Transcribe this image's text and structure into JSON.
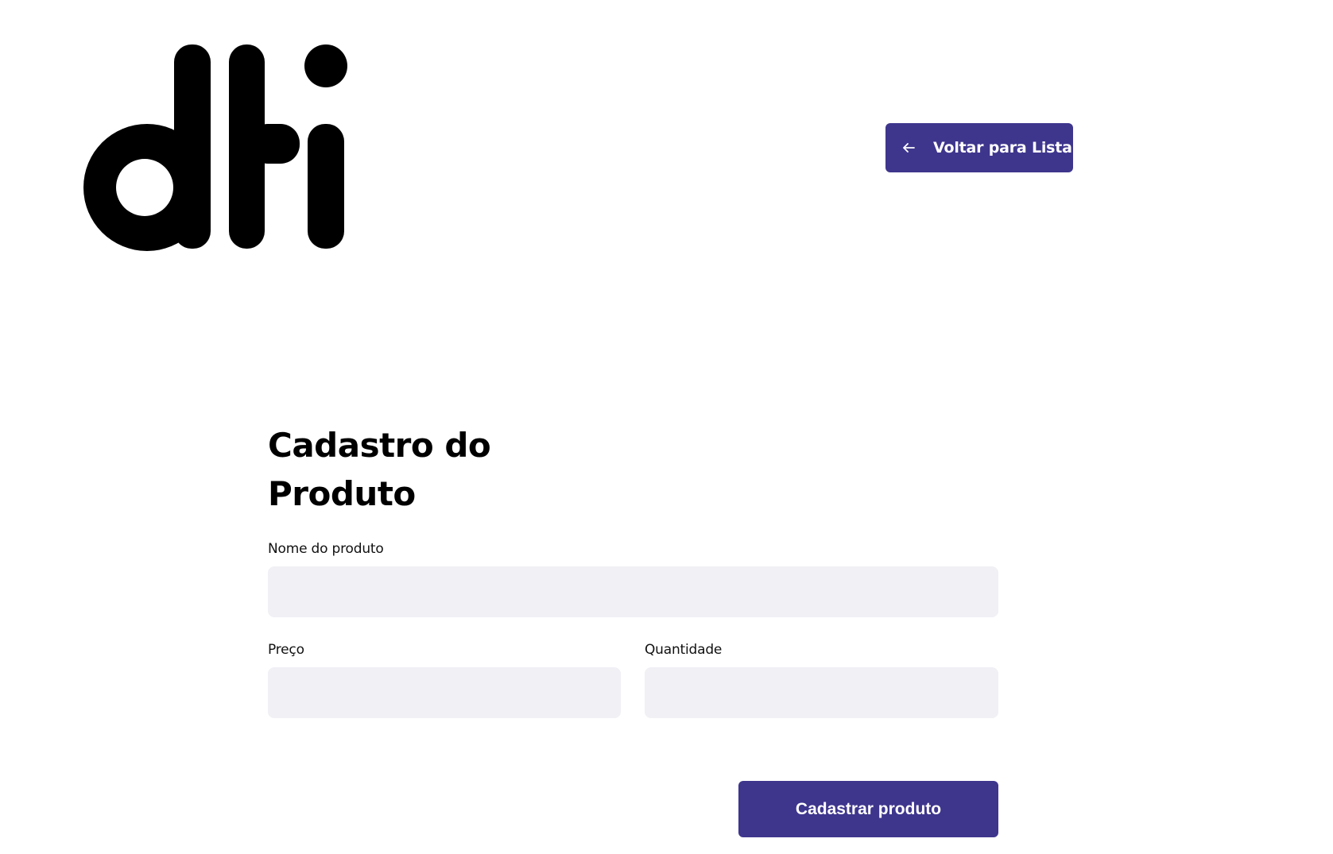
{
  "header": {
    "logo": {
      "text": "dti",
      "icon": "dti-logo"
    },
    "back_button": {
      "label": "Voltar para Lista",
      "icon": "arrow-left-icon"
    }
  },
  "form": {
    "title": "Cadastro do Produto",
    "fields": {
      "name": {
        "label": "Nome do produto",
        "value": "",
        "placeholder": ""
      },
      "price": {
        "label": "Preço",
        "value": "",
        "placeholder": ""
      },
      "quantity": {
        "label": "Quantidade",
        "value": "",
        "placeholder": ""
      }
    },
    "submit_label": "Cadastrar produto"
  },
  "colors": {
    "accent": "#3e368d",
    "input_background": "#f0f0f5",
    "text": "#000000",
    "background": "#ffffff"
  }
}
